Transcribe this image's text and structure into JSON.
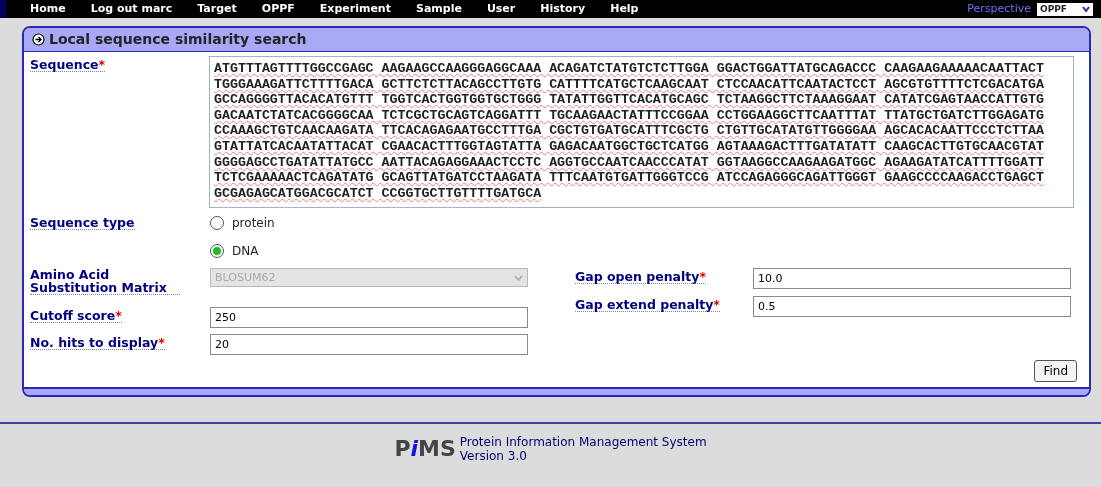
{
  "nav": {
    "items": [
      {
        "label": "Home"
      },
      {
        "label": "Log out marc"
      },
      {
        "label": "Target"
      },
      {
        "label": "OPPF"
      },
      {
        "label": "Experiment"
      },
      {
        "label": "Sample"
      },
      {
        "label": "User"
      },
      {
        "label": "History"
      },
      {
        "label": "Help"
      }
    ],
    "perspective": {
      "label": "Perspective",
      "value": "OPPF"
    }
  },
  "panel": {
    "title": "Local sequence similarity search",
    "sequence": {
      "label": "Sequence",
      "required_mark": "*",
      "lines": [
        "ATGTTTAGTTTTGGCCGAGC AAGAAGCCAAGGGAGGCAAA ACAGATCTATGTCTCTTGGA GGACTGGATTATGCAGACCC CAAGAAGAAAAACAATTACT",
        "TGGGAAAGATTCTTTTGACA GCTTCTCTTACAGCCTTGTG CATTTTCATGCTCAAGCAAT CTCCAACATTCAATACTCCT AGCGTGTTTTCTCGACATGA",
        "GCCAGGGGTTACACATGTTT TGGTCACTGGTGGTGCTGGG TATATTGGTTCACATGCAGC TCTAAGGCTTCTAAAGGAAT CATATCGAGTAACCATTGTG",
        "GACAATCTATCACGGGGCAA TCTCGCTGCAGTCAGGATTT TGCAAGAACTATTTCCGGAA CCTGGAAGGCTTCAATTTAT TTATGCTGATCTTGGAGATG",
        "CCAAAGCTGTCAACAAGATA TTCACAGAGAATGCCTTTGA CGCTGTGATGCATTTCGCTG CTGTTGCATATGTTGGGGAA AGCACACAATTCCCTCTTAA",
        "GTATTATCACAATATTACAT CGAACACTTTGGTAGTATTA GAGACAATGGCTGCTCATGG AGTAAAGACTTTGATATATT CAAGCACTTGTGCAACGTAT",
        "GGGGAGCCTGATATTATGCC AATTACAGAGGAAACTCCTC AGGTGCCAATCAACCCATAT GGTAAGGCCAAGAAGATGGC AGAAGATATCATTTTGGATT",
        "TCTCGAAAAACTCAGATATG GCAGTTATGATCCTAAGATA TTTCAATGTGATTGGGTCCG ATCCAGAGGGCAGATTGGGT GAAGCCCCAAGACCTGAGCT",
        "GCGAGAGCATGGACGCATCT CCGGTGCTTGTTTTGATGCA"
      ]
    },
    "sequence_type": {
      "label": "Sequence type",
      "options": [
        {
          "label": "protein",
          "selected": false
        },
        {
          "label": "DNA",
          "selected": true
        }
      ]
    },
    "left_fields": [
      {
        "kind": "select",
        "label": "Amino Acid Substitution Matrix",
        "value": "BLOSUM62",
        "disabled": true
      },
      {
        "kind": "input",
        "label": "Cutoff score",
        "required_mark": "*",
        "value": "250"
      },
      {
        "kind": "input",
        "label": "No. hits to display",
        "required_mark": "*",
        "value": "20"
      }
    ],
    "right_fields": [
      {
        "kind": "input",
        "label": "Gap open penalty",
        "required_mark": "*",
        "value": "10.0"
      },
      {
        "kind": "input",
        "label": "Gap extend penalty",
        "required_mark": "*",
        "value": "0.5"
      }
    ],
    "find_button": "Find"
  },
  "footer": {
    "logo": "PiMS",
    "title": "Protein Information Management System",
    "version": "Version 3.0"
  }
}
